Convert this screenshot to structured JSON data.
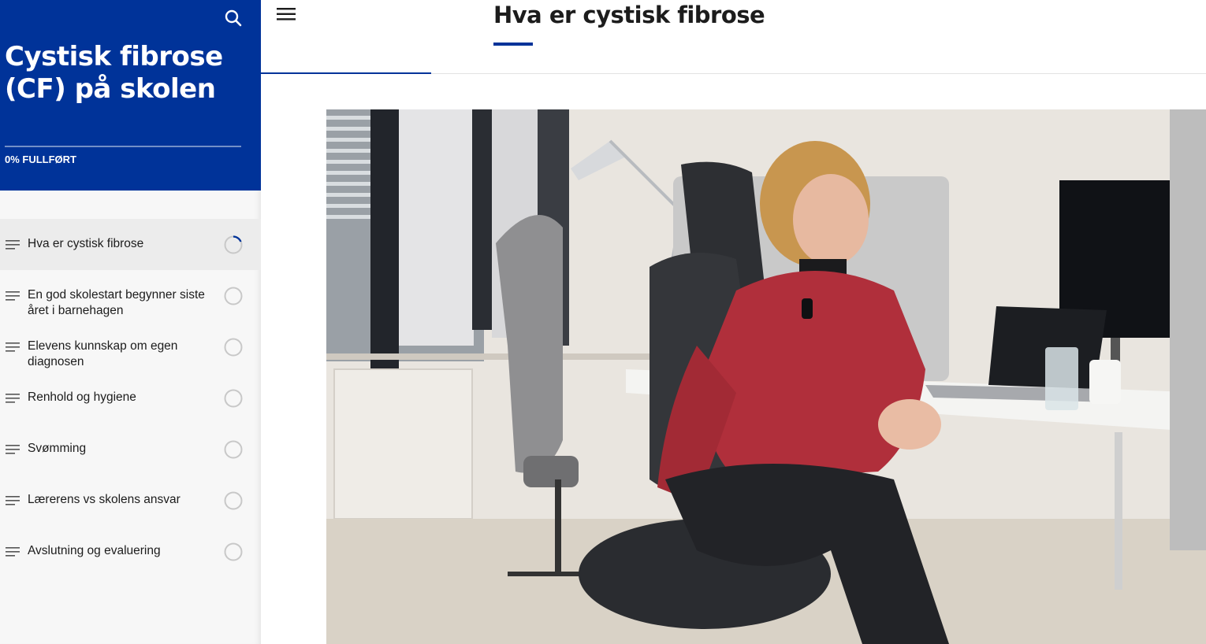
{
  "sidebar": {
    "course_title": "Cystisk fibrose (CF) på skolen",
    "progress_label": "0% FULLFØRT",
    "progress_fraction": 0,
    "search_icon": "search-icon",
    "lessons": [
      {
        "label": "Hva er cystisk fibrose",
        "active": true,
        "status_icon": "progress-ring-icon"
      },
      {
        "label": "En god skolestart begynner siste året i barnehagen",
        "active": false,
        "status_icon": "progress-ring-icon"
      },
      {
        "label": "Elevens kunnskap om egen diagnosen",
        "active": false,
        "status_icon": "progress-ring-icon"
      },
      {
        "label": "Renhold og hygiene",
        "active": false,
        "status_icon": "progress-ring-icon"
      },
      {
        "label": "Svømming",
        "active": false,
        "status_icon": "progress-ring-icon"
      },
      {
        "label": "Lærerens vs skolens ansvar",
        "active": false,
        "status_icon": "progress-ring-icon"
      },
      {
        "label": "Avslutning og evaluering",
        "active": false,
        "status_icon": "progress-ring-icon"
      }
    ]
  },
  "header": {
    "menu_icon": "hamburger-icon",
    "lesson_title": "Hva er cystisk fibrose"
  },
  "colors": {
    "brand_blue": "#003399",
    "sidebar_bg": "#f7f7f7",
    "active_item_bg": "#ececec",
    "progress_ring": "#c8c8c8",
    "progress_ring_active": "#003399"
  }
}
